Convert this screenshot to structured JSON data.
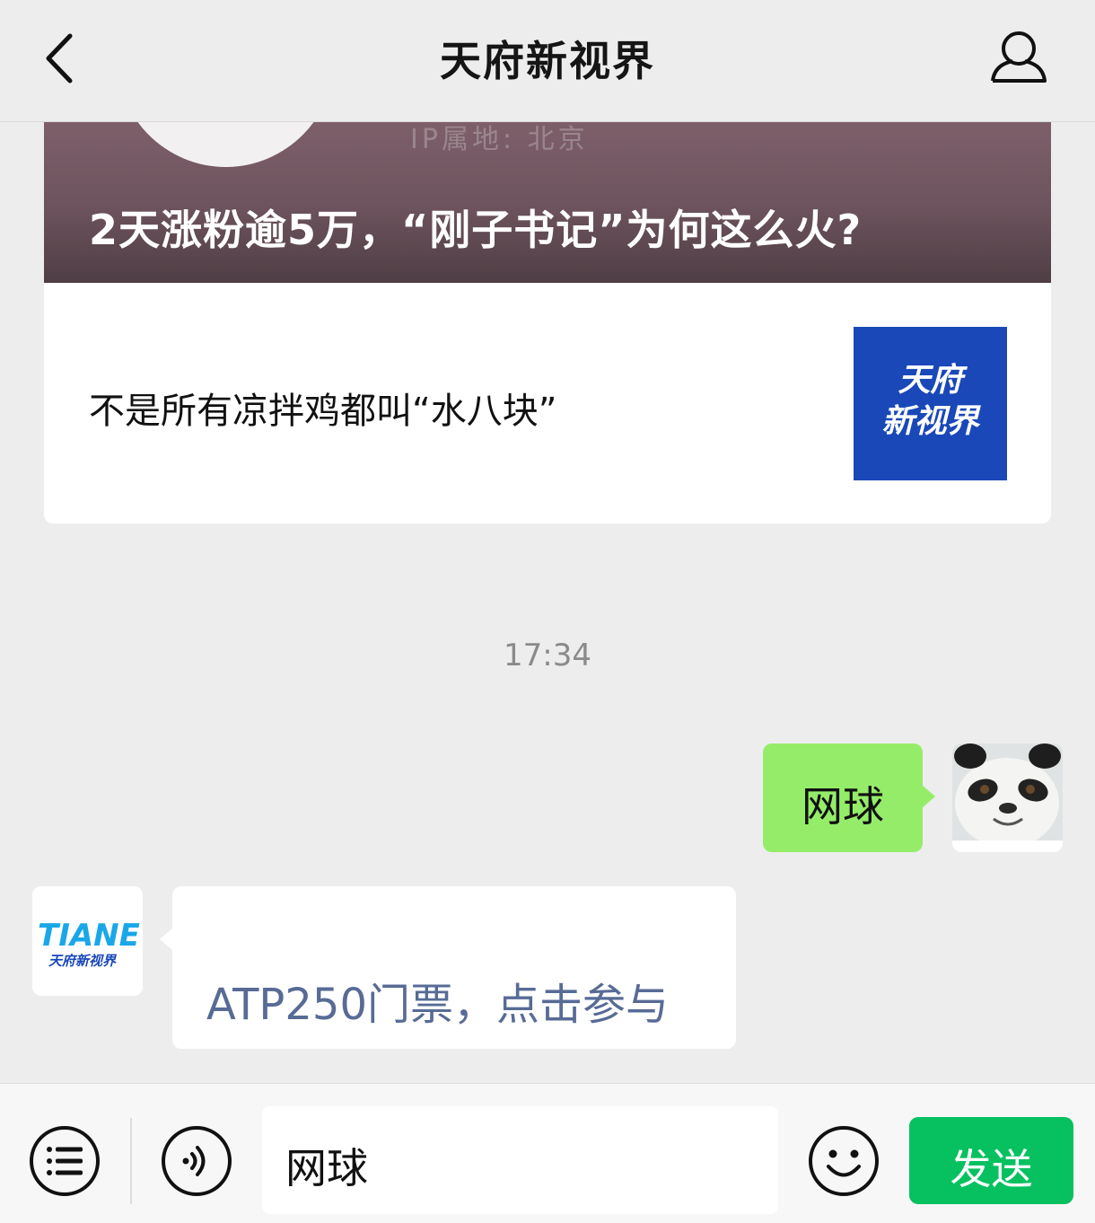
{
  "header": {
    "title": "天府新视界",
    "back_icon": "chevron-left-icon",
    "profile_icon": "person-icon"
  },
  "article_card": {
    "banner_title": "2天涨粉逾5万，“刚子书记”为何这么火?",
    "banner_blurred_text": "IP属地: 北京",
    "sub_title": "不是所有凉拌鸡都叫“水八块”",
    "thumb_line1": "天府",
    "thumb_line2": "新视界"
  },
  "chat": {
    "timestamp": "17:34",
    "outgoing": {
      "text": "网球"
    },
    "incoming": {
      "link_text": "ATP250门票，点击参与"
    },
    "bot_avatar": {
      "logo_text": "TIANEW",
      "logo_sub": "天府新视界"
    }
  },
  "composer": {
    "input_value": "网球",
    "send_label": "发送",
    "menu_icon": "list-icon",
    "voice_icon": "voice-icon",
    "emoji_icon": "emoji-icon"
  },
  "colors": {
    "outgoing_bubble": "#95ec69",
    "send_button": "#07c160",
    "link": "#576b95",
    "thumb_bg": "#1a48b8"
  }
}
